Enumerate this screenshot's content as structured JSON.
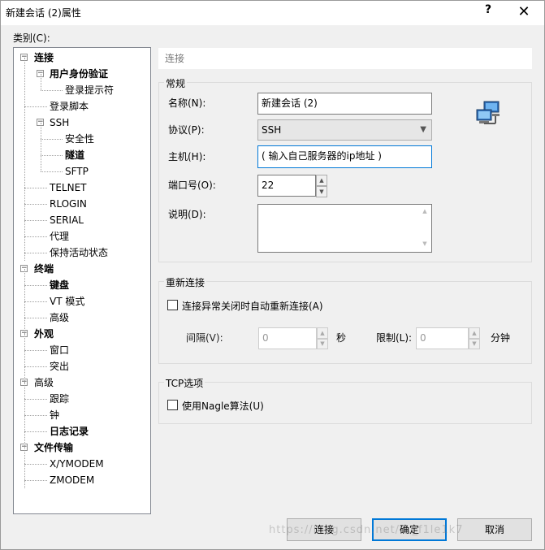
{
  "window": {
    "title": "新建会话 (2)属性",
    "help_label": "?",
    "close_label": "✕"
  },
  "category_label": "类别(C):",
  "tree": {
    "items": [
      {
        "label": "连接",
        "toggle": "−",
        "bold": true
      },
      {
        "label": "用户身份验证",
        "toggle": "−",
        "bold": true
      },
      {
        "label": "登录提示符",
        "bold": false
      },
      {
        "label": "登录脚本",
        "bold": false
      },
      {
        "label": "SSH",
        "toggle": "−",
        "bold": false
      },
      {
        "label": "安全性",
        "bold": false
      },
      {
        "label": "隧道",
        "bold": true
      },
      {
        "label": "SFTP",
        "bold": false
      },
      {
        "label": "TELNET",
        "bold": false
      },
      {
        "label": "RLOGIN",
        "bold": false
      },
      {
        "label": "SERIAL",
        "bold": false
      },
      {
        "label": "代理",
        "bold": false
      },
      {
        "label": "保持活动状态",
        "bold": false
      },
      {
        "label": "终端",
        "toggle": "−",
        "bold": true
      },
      {
        "label": "键盘",
        "bold": true
      },
      {
        "label": "VT 模式",
        "bold": false
      },
      {
        "label": "高级",
        "bold": false
      },
      {
        "label": "外观",
        "toggle": "−",
        "bold": true
      },
      {
        "label": "窗口",
        "bold": false
      },
      {
        "label": "突出",
        "bold": false
      },
      {
        "label": "高级",
        "toggle": "−",
        "bold": false
      },
      {
        "label": "跟踪",
        "bold": false
      },
      {
        "label": "钟",
        "bold": false
      },
      {
        "label": "日志记录",
        "bold": true
      },
      {
        "label": "文件传输",
        "toggle": "−",
        "bold": true
      },
      {
        "label": "X/YMODEM",
        "bold": false
      },
      {
        "label": "ZMODEM",
        "bold": false
      }
    ]
  },
  "breadcrumb": "连接",
  "general": {
    "title": "常规",
    "name_label": "名称(N):",
    "name_value": "新建会话 (2)",
    "protocol_label": "协议(P):",
    "protocol_value": "SSH",
    "host_label": "主机(H):",
    "host_value": "( 输入自己服务器的ip地址 )",
    "port_label": "端口号(O):",
    "port_value": "22",
    "desc_label": "说明(D):",
    "desc_value": ""
  },
  "reconnect": {
    "title": "重新连接",
    "checkbox_label": "连接异常关闭时自动重新连接(A)",
    "interval_label": "间隔(V):",
    "interval_value": "0",
    "interval_unit": "秒",
    "limit_label": "限制(L):",
    "limit_value": "0",
    "limit_unit": "分钟"
  },
  "tcp": {
    "title": "TCP选项",
    "nagle_label": "使用Nagle算法(U)"
  },
  "buttons": {
    "connect": "连接",
    "ok": "确定",
    "cancel": "取消"
  },
  "watermark": "https://blog.csdn.net/..._f1le1k7"
}
